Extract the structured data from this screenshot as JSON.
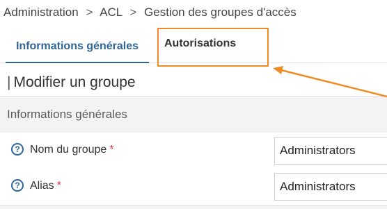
{
  "breadcrumb": {
    "items": [
      "Administration",
      "ACL",
      "Gestion des groupes d'accès"
    ],
    "separator": ">"
  },
  "tabs": [
    {
      "label": "Informations générales",
      "active": true
    },
    {
      "label": "Autorisations",
      "active": false
    }
  ],
  "page": {
    "title_prefix": "|",
    "title": "Modifier un groupe"
  },
  "panel": {
    "title": "Informations générales"
  },
  "form": {
    "required_mark": "*",
    "help_glyph": "?",
    "fields": [
      {
        "label": "Nom du groupe",
        "value": "Administrators",
        "required": true,
        "icon": "help-icon"
      },
      {
        "label": "Alias",
        "value": "Administrators",
        "required": true,
        "icon": "help-icon"
      }
    ]
  },
  "annotation": {
    "color": "#f08a24",
    "target": "Autorisations"
  },
  "colors": {
    "accent": "#2f6699",
    "required": "#d9314a",
    "panel_bg": "#f3f3f3"
  }
}
